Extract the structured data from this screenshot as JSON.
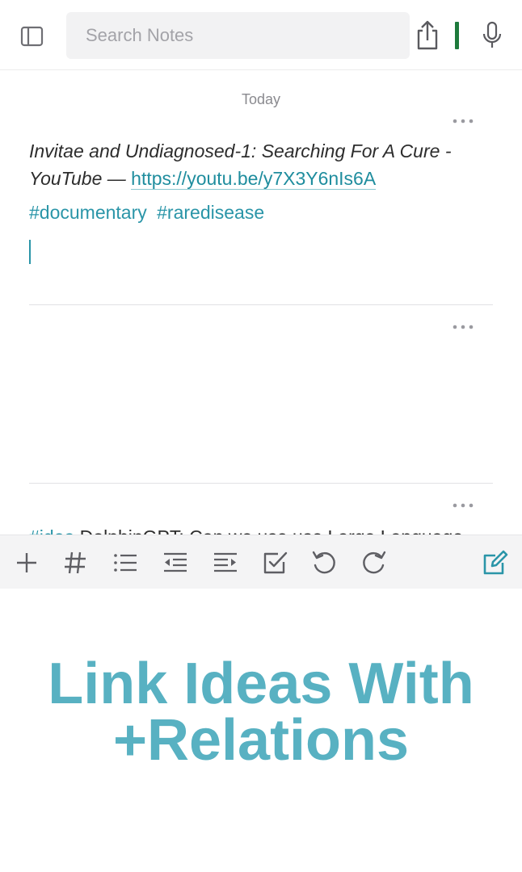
{
  "search": {
    "placeholder": "Search Notes"
  },
  "notes_list": {
    "day_label": "Today",
    "notes": [
      {
        "title": "Invitae and Undiagnosed-1: Searching For A Cure - YouTube —",
        "link": "https://youtu.be/y7X3Y6nIs6A",
        "tags": [
          "#documentary",
          "#raredisease"
        ]
      },
      {
        "tag": "#idea",
        "text": "DolphinGPT: Can we use use Large Language"
      }
    ]
  },
  "headline": {
    "line1": "Link Ideas With",
    "line2": "+Relations"
  },
  "colors": {
    "accent": "#2a95a8",
    "headline": "#58b1c2",
    "sync_indicator": "#1e7a3c",
    "toolbar_bg": "#f4f4f5"
  },
  "icons": {
    "top": [
      "sidebar-toggle-icon",
      "share-icon",
      "sync-status-indicator",
      "microphone-icon"
    ],
    "toolbar": [
      "plus-icon",
      "hashtag-icon",
      "bullet-list-icon",
      "outdent-icon",
      "indent-icon",
      "checkbox-icon",
      "undo-icon",
      "redo-icon",
      "compose-icon"
    ]
  }
}
